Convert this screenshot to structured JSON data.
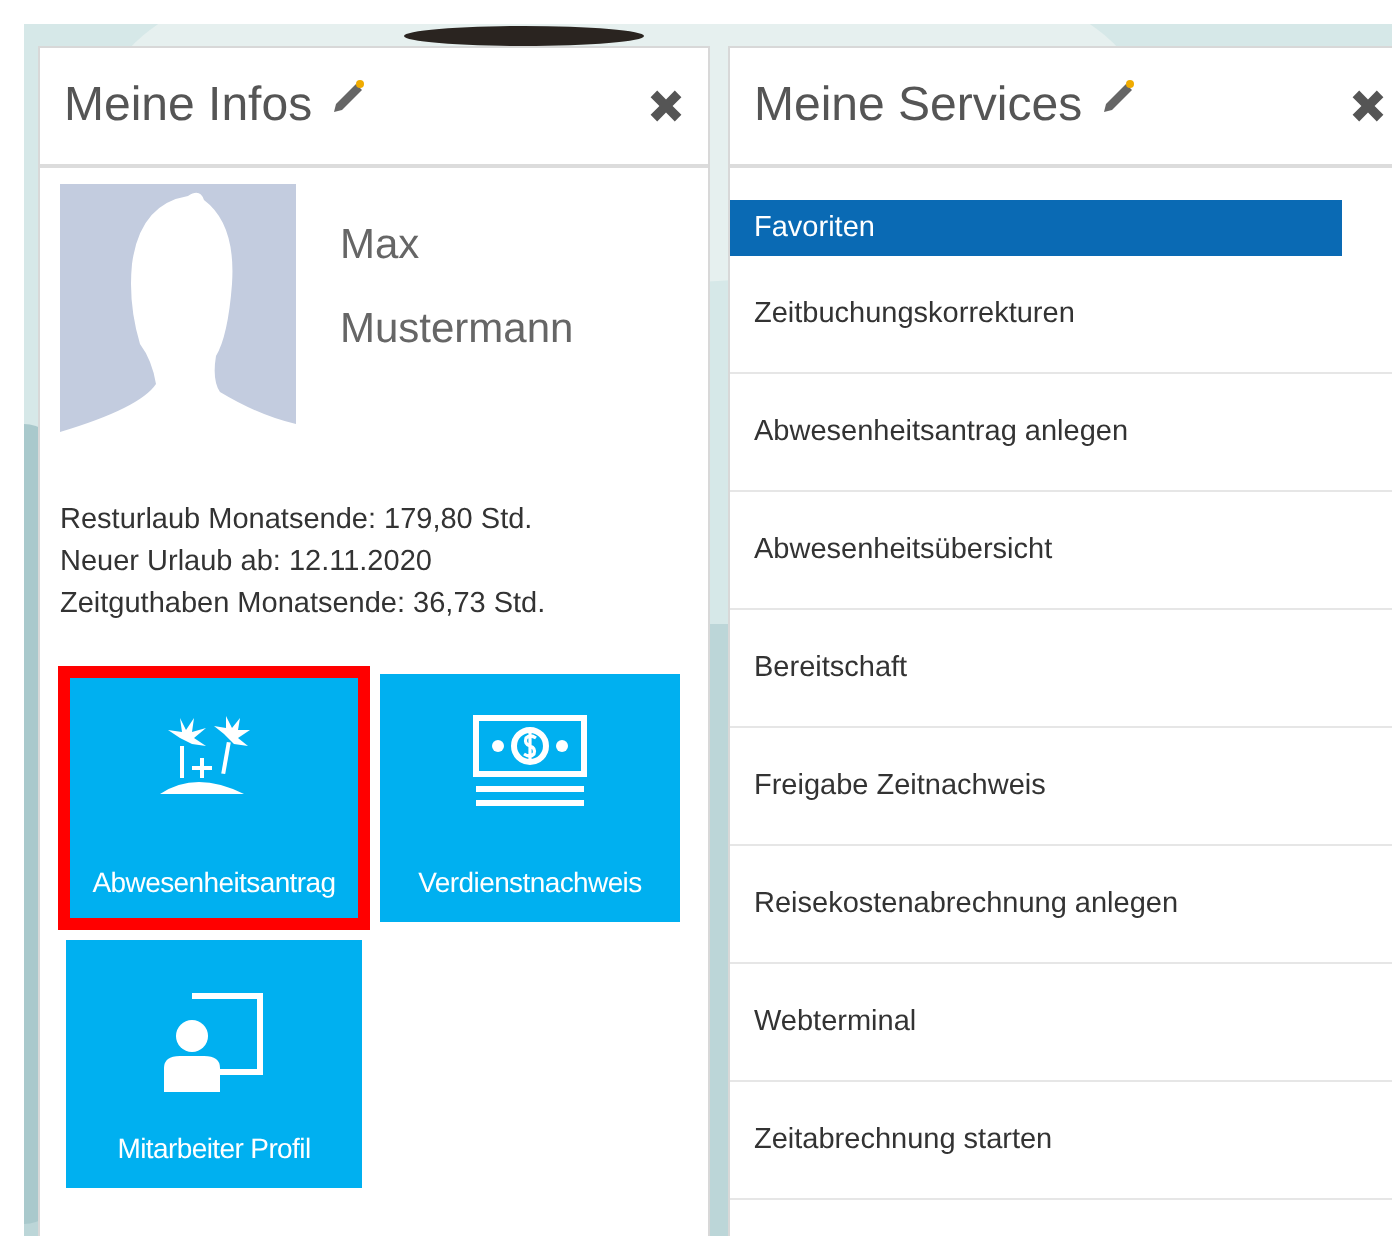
{
  "panels": [
    {
      "kind": "infos",
      "title": "Meine Infos",
      "profile": {
        "first_name": "Max",
        "last_name": "Mustermann"
      },
      "facts": [
        "Resturlaub Monatsende: 179,80 Std.",
        "Neuer Urlaub ab: 12.11.2020",
        "Zeitguthaben Monatsende: 36,73 Std."
      ],
      "tiles": [
        {
          "kind": "vacation",
          "label": "Abwesenheitsantrag",
          "highlighted": true
        },
        {
          "kind": "money",
          "label": "Verdienstnachweis",
          "highlighted": false
        },
        {
          "kind": "profile",
          "label": "Mitarbeiter Profil",
          "highlighted": false
        }
      ]
    },
    {
      "kind": "services",
      "title": "Meine Services",
      "group": "Favoriten",
      "items": [
        "Zeitbuchungskorrekturen",
        "Abwesenheitsantrag anlegen",
        "Abwesenheitsübersicht",
        "Bereitschaft",
        "Freigabe Zeitnachweis",
        "Reisekostenabrechnung anlegen",
        "Webterminal",
        "Zeitabrechnung starten"
      ]
    }
  ]
}
